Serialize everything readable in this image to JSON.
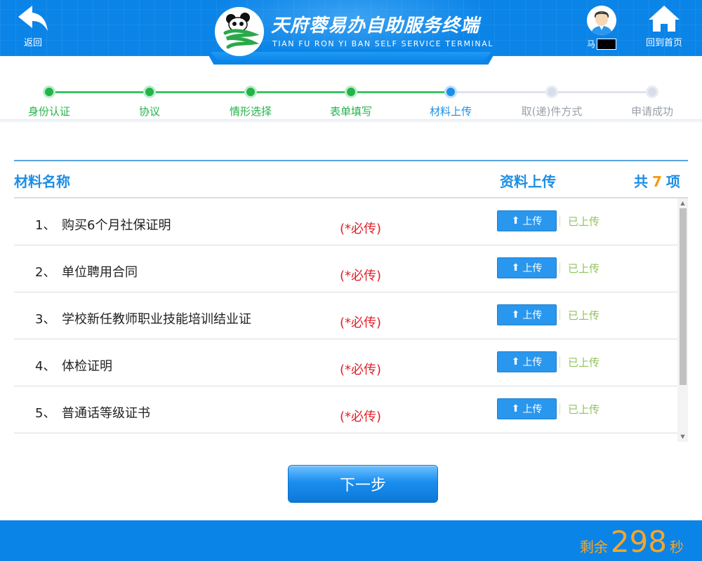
{
  "header": {
    "back_label": "返回",
    "title_zh": "天府蓉易办自助服务终端",
    "title_en": "TIAN FU RON YI BAN SELF SERVICE TERMINAL",
    "user_name": "马",
    "home_label": "回到首页"
  },
  "steps": [
    {
      "label": "身份认证",
      "state": "done"
    },
    {
      "label": "协议",
      "state": "done"
    },
    {
      "label": "情形选择",
      "state": "done"
    },
    {
      "label": "表单填写",
      "state": "done"
    },
    {
      "label": "材料上传",
      "state": "active"
    },
    {
      "label": "取(递)件方式",
      "state": "todo"
    },
    {
      "label": "申请成功",
      "state": "todo"
    }
  ],
  "table": {
    "col_name": "材料名称",
    "col_upload": "资料上传",
    "total_prefix": "共",
    "total_count": "7",
    "total_suffix": "项",
    "rows": [
      {
        "no": "1、",
        "name": "购买6个月社保证明",
        "required": "(*必传)",
        "upload_label": "上传",
        "status": "已上传"
      },
      {
        "no": "2、",
        "name": "单位聘用合同",
        "required": "(*必传)",
        "upload_label": "上传",
        "status": "已上传"
      },
      {
        "no": "3、",
        "name": "学校新任教师职业技能培训结业证",
        "required": "(*必传)",
        "upload_label": "上传",
        "status": "已上传"
      },
      {
        "no": "4、",
        "name": "体检证明",
        "required": "(*必传)",
        "upload_label": "上传",
        "status": "已上传"
      },
      {
        "no": "5、",
        "name": "普通话等级证书",
        "required": "(*必传)",
        "upload_label": "上传",
        "status": "已上传"
      }
    ]
  },
  "next_label": "下一步",
  "countdown": {
    "prefix": "剩余",
    "value": "298",
    "suffix": "秒"
  },
  "colors": {
    "primary": "#0b84e8",
    "done": "#23b34a",
    "active": "#1c8ee6",
    "required": "#e0202a",
    "uploaded": "#8fc45a",
    "countdown": "#f4a62a"
  }
}
